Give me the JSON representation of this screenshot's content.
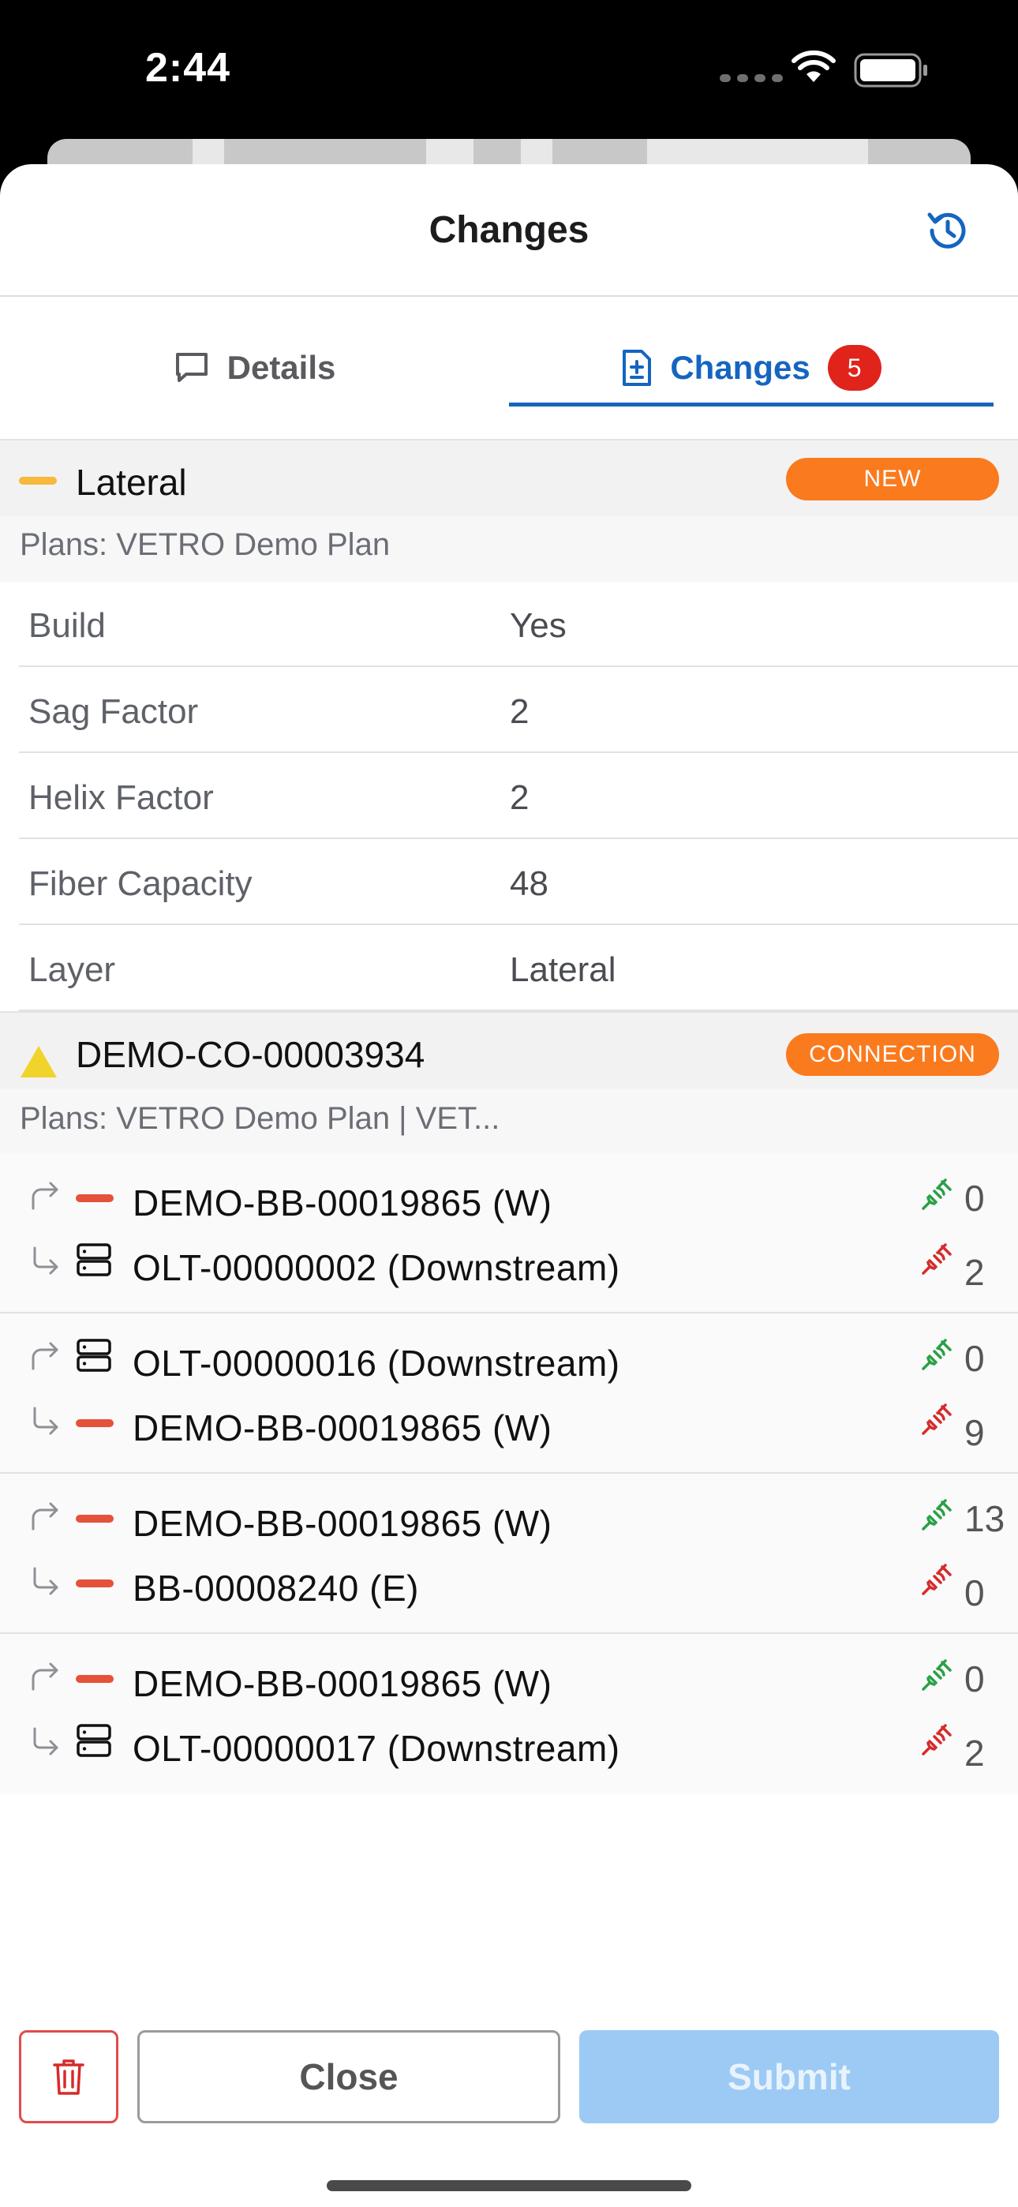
{
  "status_bar": {
    "time": "2:44"
  },
  "header": {
    "title": "Changes",
    "history_icon": "history-icon"
  },
  "tabs": {
    "details_label": "Details",
    "changes_label": "Changes",
    "changes_count": "5",
    "active": "changes"
  },
  "sections": [
    {
      "title": "Lateral",
      "tag": "NEW",
      "plans": "Plans: VETRO Demo Plan",
      "icon": "lateral-line-icon",
      "properties": [
        {
          "label": "Build",
          "value": "Yes"
        },
        {
          "label": "Sag Factor",
          "value": "2"
        },
        {
          "label": "Helix Factor",
          "value": "2"
        },
        {
          "label": "Fiber Capacity",
          "value": "48"
        },
        {
          "label": "Layer",
          "value": "Lateral"
        }
      ]
    },
    {
      "title": "DEMO-CO-00003934",
      "tag": "CONNECTION",
      "plans": "Plans: VETRO Demo Plan  |  VET...",
      "icon": "warning-triangle-icon",
      "connections": [
        {
          "from": "DEMO-BB-00019865  (W)",
          "to": "OLT-00000002  (Downstream)",
          "connected": "0",
          "disconnected": "2"
        },
        {
          "from": "OLT-00000016  (Downstream)",
          "to": "DEMO-BB-00019865  (W)",
          "connected": "0",
          "disconnected": "9"
        },
        {
          "from": "DEMO-BB-00019865  (W)",
          "to": "BB-00008240  (E)",
          "connected": "13",
          "disconnected": "0"
        },
        {
          "from": "DEMO-BB-00019865  (W)",
          "to": "OLT-00000017  (Downstream)",
          "connected": "0",
          "disconnected": "2"
        }
      ]
    }
  ],
  "footer": {
    "close_label": "Close",
    "submit_label": "Submit"
  },
  "colors": {
    "accent": "#1565c0",
    "badge": "#e0241b",
    "tag": "#fa7a1e",
    "lateral": "#f6b93b",
    "cable": "#e4523b"
  }
}
